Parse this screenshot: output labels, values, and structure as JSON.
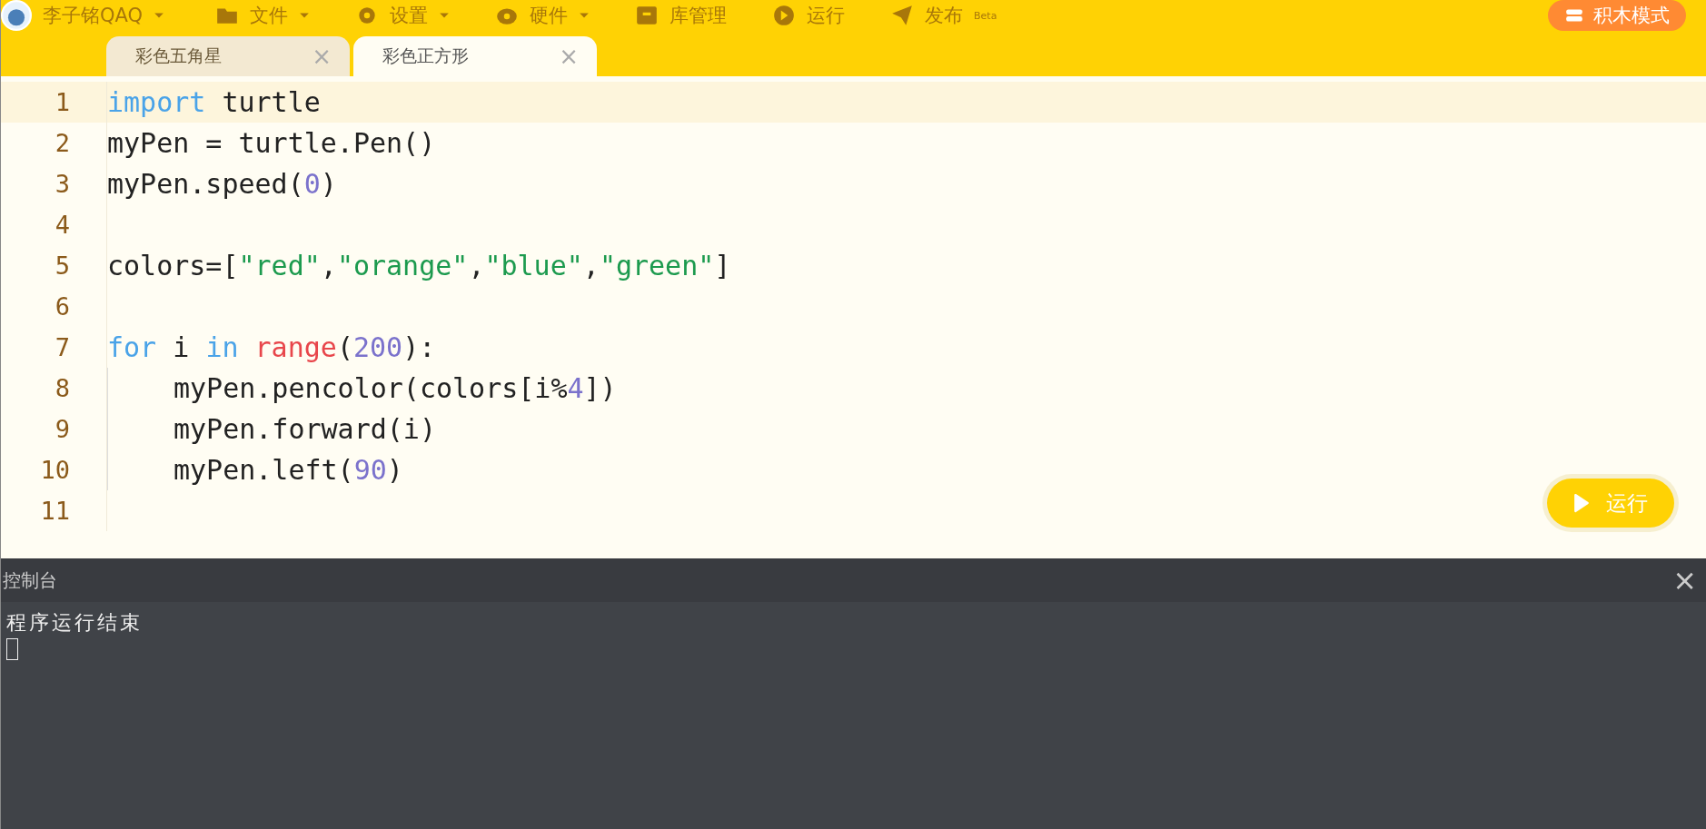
{
  "menu_bar": {
    "user": {
      "name": "李子铭QAQ",
      "has_caret": true
    },
    "items": [
      {
        "label": "文件",
        "has_caret": true
      },
      {
        "label": "设置",
        "has_caret": true
      },
      {
        "label": "硬件",
        "has_caret": true
      },
      {
        "label": "库管理",
        "has_caret": false
      },
      {
        "label": "运行",
        "has_caret": false
      },
      {
        "label": "发布$^{Beta}$",
        "has_caret": false
      }
    ],
    "mode_button": "积木模式"
  },
  "tabs": [
    {
      "label": "彩色五角星",
      "close": "×",
      "selected": false
    },
    {
      "label": "彩色正方形",
      "close": "×",
      "selected": true
    }
  ],
  "editor": {
    "lines": [
      {
        "number": "1",
        "selected": true,
        "indented": false,
        "tokens": [
          {
            "kind": "keyword",
            "text": "import"
          },
          {
            "kind": "plain",
            "text": " turtle"
          }
        ]
      },
      {
        "number": "2",
        "selected": false,
        "indented": false,
        "tokens": [
          {
            "kind": "plain",
            "text": "myPen = turtle.Pen()"
          }
        ]
      },
      {
        "number": "3",
        "selected": false,
        "indented": false,
        "tokens": [
          {
            "kind": "plain",
            "text": "myPen.speed("
          },
          {
            "kind": "number",
            "text": "0"
          },
          {
            "kind": "plain",
            "text": ")"
          }
        ]
      },
      {
        "number": "4",
        "selected": false,
        "indented": false
      },
      {
        "number": "5",
        "selected": false,
        "indented": false,
        "tokens": [
          {
            "kind": "plain",
            "text": "colors=["
          },
          {
            "kind": "string",
            "text": "\"red\""
          },
          {
            "kind": "plain",
            "text": ","
          },
          {
            "kind": "string",
            "text": "\"orange\""
          },
          {
            "kind": "plain",
            "text": ","
          },
          {
            "kind": "string",
            "text": "\"blue\""
          },
          {
            "kind": "plain",
            "text": ","
          },
          {
            "kind": "string",
            "text": "\"green\""
          },
          {
            "kind": "plain",
            "text": "]"
          }
        ]
      },
      {
        "number": "6",
        "selected": false,
        "indented": false
      },
      {
        "number": "7",
        "selected": false,
        "indented": false,
        "tokens": [
          {
            "kind": "keyword",
            "text": "for"
          },
          {
            "kind": "plain",
            "text": " i "
          },
          {
            "kind": "keyword",
            "text": "in"
          },
          {
            "kind": "builtin",
            "text": " range"
          },
          {
            "kind": "plain",
            "text": "("
          },
          {
            "kind": "number",
            "text": "200"
          },
          {
            "kind": "plain",
            "text": "):"
          }
        ]
      },
      {
        "number": "8",
        "selected": false,
        "indented": true,
        "tokens": [
          {
            "kind": "plain",
            "text": "myPen.pencolor(colors[i%"
          },
          {
            "kind": "number",
            "text": "4"
          },
          {
            "kind": "plain",
            "text": "])"
          }
        ]
      },
      {
        "number": "9",
        "selected": false,
        "indented": true,
        "tokens": [
          {
            "kind": "plain",
            "text": "myPen.forward(i)"
          }
        ]
      },
      {
        "number": "10",
        "selected": false,
        "indented": true,
        "tokens": [
          {
            "kind": "plain",
            "text": "myPen.left("
          },
          {
            "kind": "number",
            "text": "90"
          },
          {
            "kind": "plain",
            "text": ")"
          }
        ]
      },
      {
        "number": "11",
        "selected": false,
        "indented": false
      }
    ],
    "run_button": "运行"
  },
  "console": {
    "title": "控制台",
    "close": "×",
    "output": [
      "程序运行结束"
    ]
  }
}
